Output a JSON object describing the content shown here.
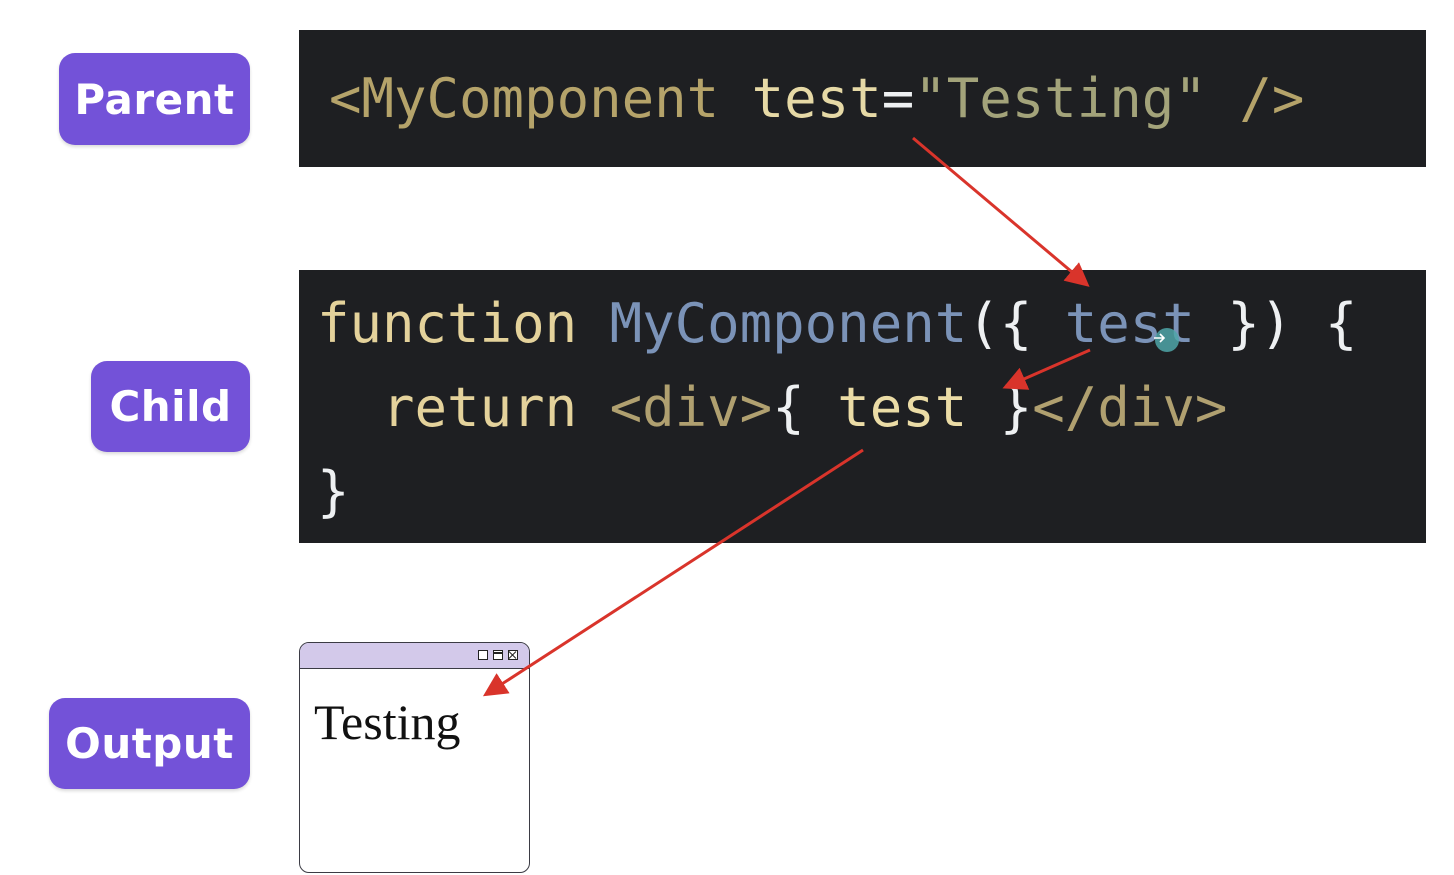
{
  "labels": {
    "parent": "Parent",
    "child": "Child",
    "output": "Output"
  },
  "parent_code": {
    "tag_open": "<MyComponent",
    "attr_name": "test",
    "equals": "=",
    "attr_value": "\"Testing\"",
    "tag_close": "/>"
  },
  "child_code": {
    "line1_keyword": "function",
    "line1_name": "MyComponent",
    "line1_open": "({",
    "line1_param": "test",
    "line1_close": "}) {",
    "line2_keyword": "return",
    "line2_div_open": "<div>",
    "line2_brace_open": "{",
    "line2_var": "test",
    "line2_brace_close": "}",
    "line2_div_close": "</div>",
    "line3_brace": "}"
  },
  "output": {
    "text": "Testing"
  },
  "colors": {
    "pill_bg": "#7352d8",
    "code_bg": "#1e1f22",
    "arrow": "#d9342b",
    "window_titlebar": "#d3c9ea"
  }
}
